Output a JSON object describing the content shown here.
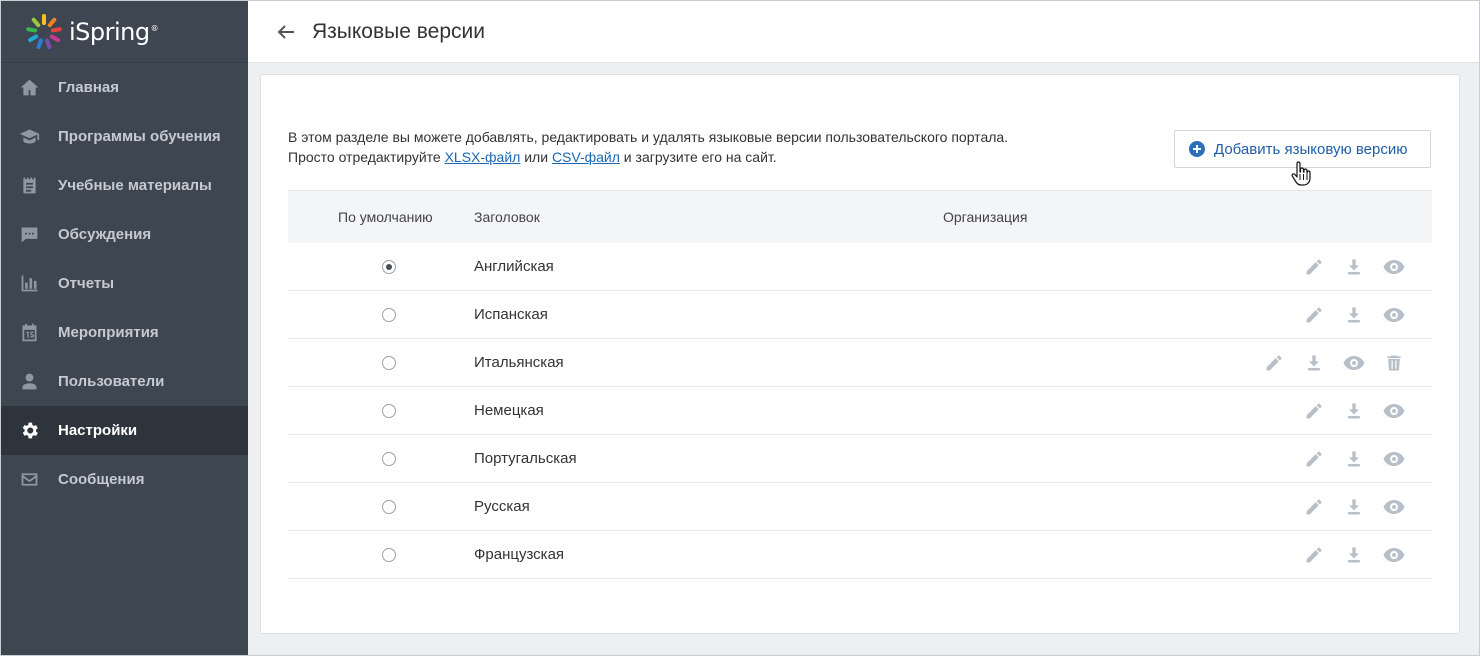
{
  "app": {
    "logo_text": "iSpring",
    "logo_mark": "®"
  },
  "sidebar": {
    "items": [
      {
        "label": "Главная",
        "icon": "home-icon"
      },
      {
        "label": "Программы обучения",
        "icon": "graduation-cap-icon"
      },
      {
        "label": "Учебные материалы",
        "icon": "notepad-icon"
      },
      {
        "label": "Обсуждения",
        "icon": "chat-icon"
      },
      {
        "label": "Отчеты",
        "icon": "bar-chart-icon"
      },
      {
        "label": "Мероприятия",
        "icon": "calendar-icon"
      },
      {
        "label": "Пользователи",
        "icon": "user-icon"
      },
      {
        "label": "Настройки",
        "icon": "gear-icon",
        "active": true
      },
      {
        "label": "Сообщения",
        "icon": "envelope-icon"
      }
    ]
  },
  "header": {
    "title": "Языковые версии"
  },
  "intro": {
    "line1": "В этом разделе вы можете добавлять, редактировать и удалять языковые версии пользовательского портала.",
    "line2_prefix": "Просто отредактируйте ",
    "xlsx_link": "XLSX-файл",
    "middle": " или ",
    "csv_link": "CSV-файл",
    "line2_suffix": " и загрузите его на сайт."
  },
  "add_button": {
    "label": "Добавить языковую версию"
  },
  "table": {
    "columns": {
      "default": "По умолчанию",
      "title": "Заголовок",
      "organization": "Организация"
    },
    "rows": [
      {
        "title": "Английская",
        "organization": "",
        "default": true,
        "actions": [
          "edit",
          "download",
          "view"
        ]
      },
      {
        "title": "Испанская",
        "organization": "",
        "default": false,
        "actions": [
          "edit",
          "download",
          "view"
        ]
      },
      {
        "title": "Итальянская",
        "organization": "",
        "default": false,
        "actions": [
          "edit",
          "download",
          "view",
          "delete"
        ]
      },
      {
        "title": "Немецкая",
        "organization": "",
        "default": false,
        "actions": [
          "edit",
          "download",
          "view"
        ]
      },
      {
        "title": "Португальская",
        "organization": "",
        "default": false,
        "actions": [
          "edit",
          "download",
          "view"
        ]
      },
      {
        "title": "Русская",
        "organization": "",
        "default": false,
        "actions": [
          "edit",
          "download",
          "view"
        ]
      },
      {
        "title": "Французская",
        "organization": "",
        "default": false,
        "actions": [
          "edit",
          "download",
          "view"
        ]
      }
    ]
  },
  "colors": {
    "sidebar_bg": "#3e4751",
    "sidebar_active_bg": "#2d343c",
    "link": "#1a66b3",
    "accent": "#2d6fb8",
    "action_icon": "#b7bfc8"
  }
}
